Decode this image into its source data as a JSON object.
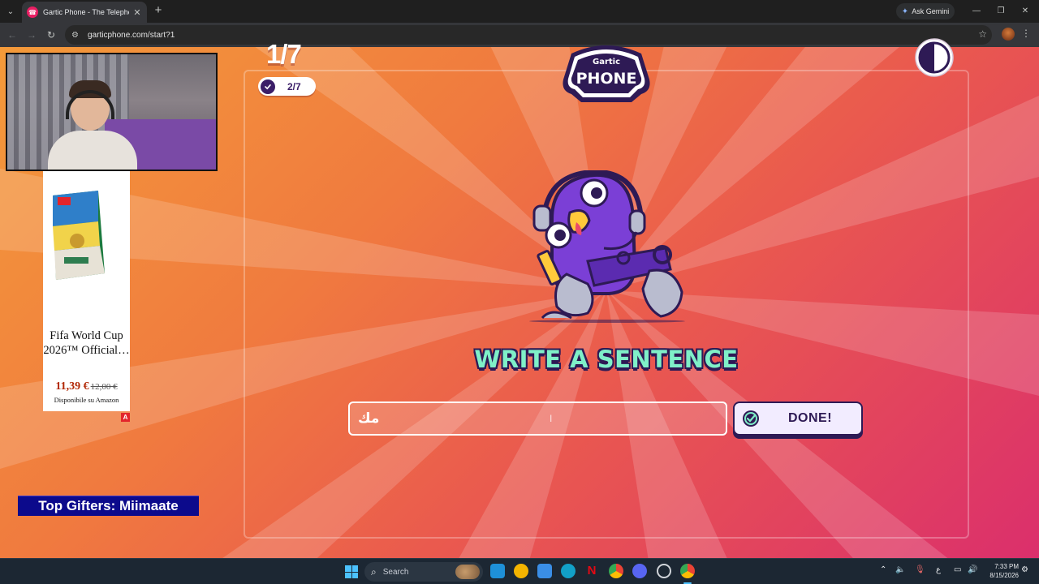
{
  "browser": {
    "tab_title": "Gartic Phone - The Telephone G",
    "tab_close": "✕",
    "new_tab": "+",
    "gemini_label": "Ask Gemini",
    "url": "garticphone.com/start?1",
    "window_controls": {
      "minimize": "—",
      "restore": "❐",
      "close": "✕"
    },
    "icons": [
      "tab-search-icon",
      "gartic-favicon",
      "back-icon",
      "forward-icon",
      "reload-icon",
      "site-info-icon",
      "bookmark-star-icon",
      "profile-avatar",
      "menu-kebab-icon"
    ]
  },
  "game": {
    "round": "1/7",
    "completed": "2/7",
    "logo_top": "Gartic",
    "logo_bottom": "PHONE",
    "headline": "WRITE A SENTENCE",
    "input_value": "مك",
    "done_label": "DONE!",
    "colors": {
      "accent_purple": "#2e1a55",
      "headline_green": "#7ff0c8",
      "bg_orange": "#f49a3a",
      "bg_pink": "#db2f6c"
    }
  },
  "overlay": {
    "ad": {
      "title": "Fifa World Cup 2026™ Official…",
      "price": "11,39 €",
      "old_price": "12,00 €",
      "availability": "Disponibile su Amazon",
      "badge": "A"
    },
    "gifters": "Top Gifters: Miimaate"
  },
  "taskbar": {
    "search_label": "Search",
    "time": "7:33 PM",
    "date": "8/15/2026",
    "keyboard_lang": "ع",
    "apps": [
      "file-explorer-icon",
      "chat-icon",
      "store-icon",
      "edge-icon",
      "netflix-icon",
      "chrome-icon",
      "discord-icon",
      "github-icon",
      "chrome-active-icon"
    ]
  }
}
